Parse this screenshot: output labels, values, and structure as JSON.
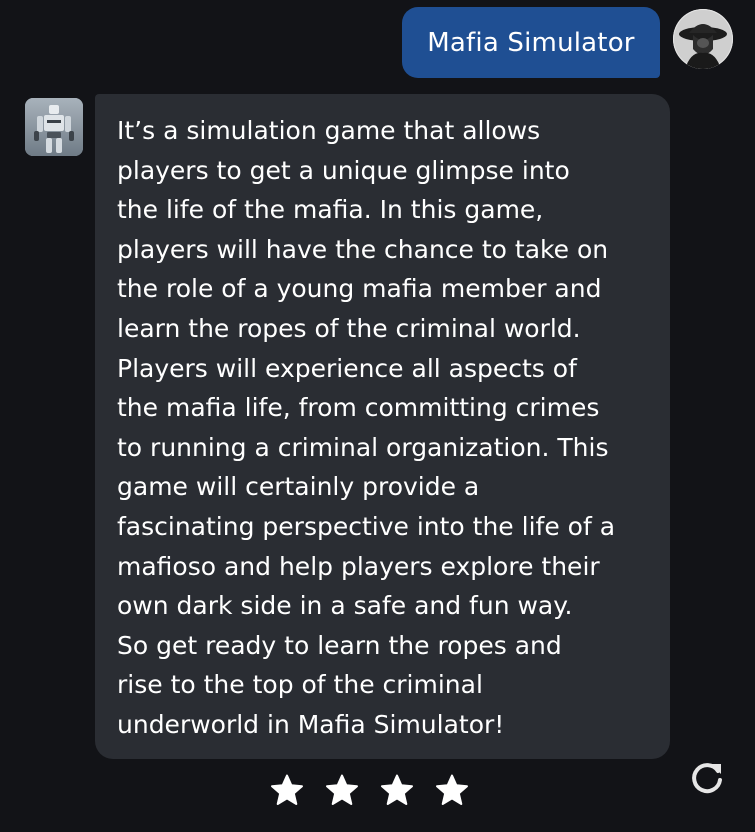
{
  "conversation": {
    "user_message": "Mafia Simulator",
    "bot_message_lines": [
      "It’s a simulation game that allows",
      "players to get a unique glimpse into",
      "the life of the mafia. In this game,",
      "players will have the chance to take on",
      "the role of a young mafia member and",
      "learn the ropes of the criminal world.",
      "Players will experience all aspects of",
      "the mafia life, from committing crimes",
      "to running a criminal organization. This",
      "game will certainly provide a",
      "fascinating perspective into the life of a",
      "mafioso and help players explore their",
      "own dark side in a safe and fun way.",
      "So get ready to learn the ropes and",
      "rise to the top of the criminal",
      "underworld in Mafia Simulator!"
    ]
  },
  "rating": {
    "stars_total": 4,
    "icon": "star-icon"
  },
  "actions": {
    "regenerate_icon": "refresh-icon"
  },
  "colors": {
    "background": "#121317",
    "user_bubble": "#1f4f93",
    "bot_bubble": "#2a2d33",
    "text": "#ffffff",
    "star": "#ffffff"
  }
}
